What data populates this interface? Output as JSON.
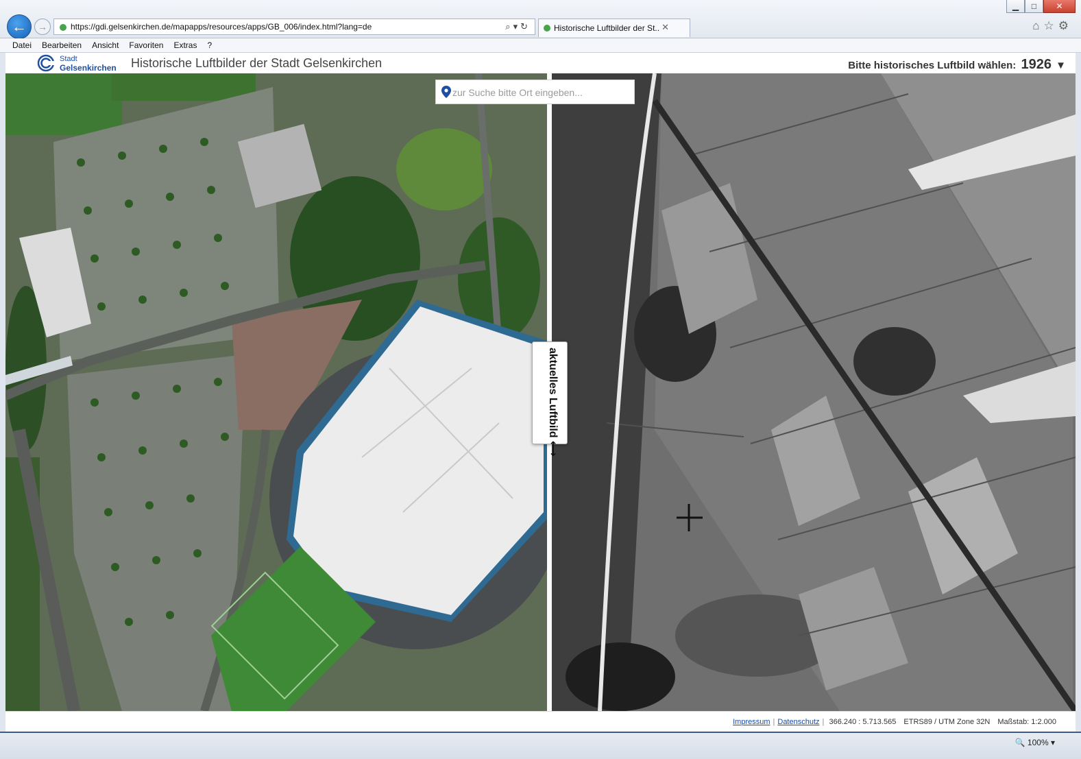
{
  "browser": {
    "url": "https://gdi.gelsenkirchen.de/mapapps/resources/apps/GB_006/index.html?lang=de",
    "tab_title": "Historische Luftbilder der St...",
    "window_controls": {
      "minimize": "▁",
      "maximize": "□",
      "close": "✕"
    },
    "menu": [
      "Datei",
      "Bearbeiten",
      "Ansicht",
      "Favoriten",
      "Extras",
      "?"
    ],
    "zoom": "100%"
  },
  "app": {
    "logo_line1": "Stadt",
    "logo_line2": "Gelsenkirchen",
    "title": "Historische Luftbilder der Stadt Gelsenkirchen",
    "year_prompt": "Bitte historisches Luftbild wählen:",
    "year_value": "1926",
    "search_placeholder": "zur Suche bitte Ort eingeben...",
    "swipe_label": "aktuelles Luftbild ⟷"
  },
  "status": {
    "impressum": "Impressum",
    "datenschutz": "Datenschutz",
    "coordinates": "366.240 : 5.713.565",
    "crs": "ETRS89 / UTM Zone 32N",
    "scale": "Maßstab: 1:2.000"
  },
  "colors": {
    "link": "#1a4aa0",
    "brand": "#1e4fa3",
    "accent_back": "#1660b5"
  }
}
